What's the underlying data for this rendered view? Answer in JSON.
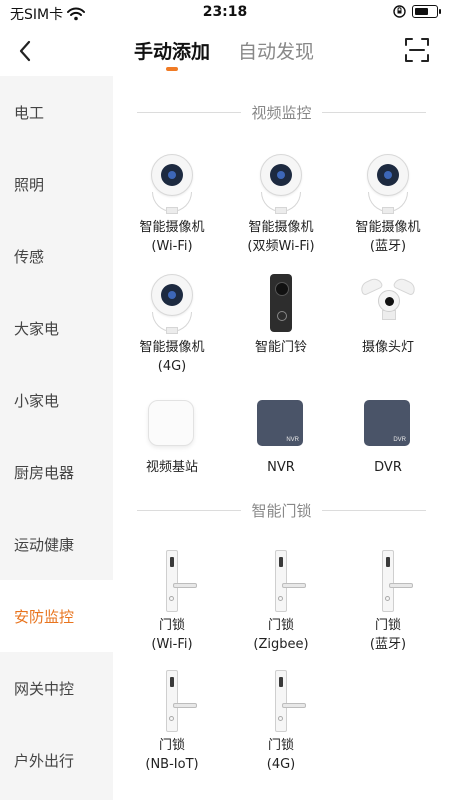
{
  "status_bar": {
    "carrier": "无SIM卡",
    "time": "23:18"
  },
  "header": {
    "tabs": [
      {
        "label": "手动添加",
        "active": true
      },
      {
        "label": "自动发现",
        "active": false
      }
    ]
  },
  "sidebar": {
    "items": [
      {
        "label": "电工"
      },
      {
        "label": "照明"
      },
      {
        "label": "传感"
      },
      {
        "label": "大家电"
      },
      {
        "label": "小家电"
      },
      {
        "label": "厨房电器"
      },
      {
        "label": "运动健康"
      },
      {
        "label": "安防监控",
        "active": true
      },
      {
        "label": "网关中控"
      },
      {
        "label": "户外出行"
      }
    ]
  },
  "main": {
    "sections": [
      {
        "title": "视频监控",
        "devices": [
          {
            "line1": "智能摄像机",
            "line2": "(Wi-Fi)",
            "icon": "camera-icon"
          },
          {
            "line1": "智能摄像机",
            "line2": "(双频Wi-Fi)",
            "icon": "camera-icon"
          },
          {
            "line1": "智能摄像机",
            "line2": "(蓝牙)",
            "icon": "camera-icon"
          },
          {
            "line1": "智能摄像机",
            "line2": "(4G)",
            "icon": "camera-icon"
          },
          {
            "line1": "智能门铃",
            "line2": "",
            "icon": "doorbell-icon"
          },
          {
            "line1": "摄像头灯",
            "line2": "",
            "icon": "floodlight-camera-icon"
          },
          {
            "line1": "视频基站",
            "line2": "",
            "icon": "video-base-station-icon"
          },
          {
            "line1": "NVR",
            "line2": "",
            "icon": "nvr-icon",
            "device_text": "NVR"
          },
          {
            "line1": "DVR",
            "line2": "",
            "icon": "dvr-icon",
            "device_text": "DVR"
          }
        ]
      },
      {
        "title": "智能门锁",
        "devices": [
          {
            "line1": "门锁",
            "line2": "(Wi-Fi)",
            "icon": "door-lock-icon"
          },
          {
            "line1": "门锁",
            "line2": "(Zigbee)",
            "icon": "door-lock-icon"
          },
          {
            "line1": "门锁",
            "line2": "(蓝牙)",
            "icon": "door-lock-icon"
          },
          {
            "line1": "门锁",
            "line2": "(NB-IoT)",
            "icon": "door-lock-icon"
          },
          {
            "line1": "门锁",
            "line2": "(4G)",
            "icon": "door-lock-icon"
          }
        ]
      }
    ]
  },
  "colors": {
    "accent": "#e8741e",
    "sidebar_bg": "#f5f5f5"
  }
}
